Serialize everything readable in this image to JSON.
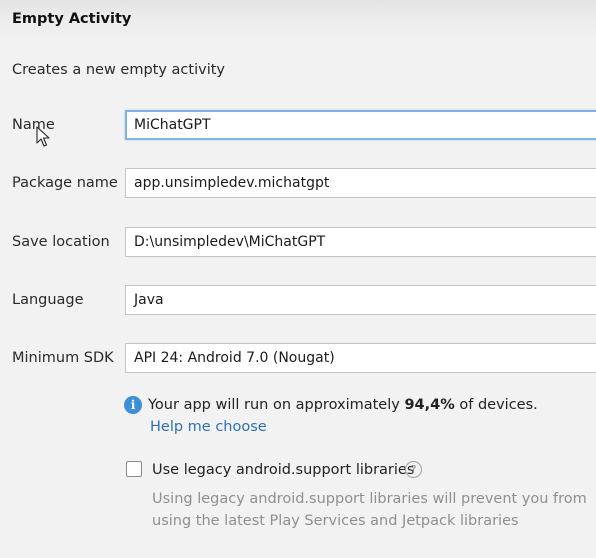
{
  "header": {
    "title": "Empty Activity"
  },
  "subtitle": "Creates a new empty activity",
  "form": {
    "name": {
      "label": "Name",
      "value": "MiChatGPT"
    },
    "package": {
      "label": "Package name",
      "value": "app.unsimpledev.michatgpt"
    },
    "save_location": {
      "label": "Save location",
      "value": "D:\\unsimpledev\\MiChatGPT"
    },
    "language": {
      "label": "Language",
      "value": "Java"
    },
    "min_sdk": {
      "label": "Minimum SDK",
      "value": "API 24: Android 7.0 (Nougat)"
    }
  },
  "info": {
    "icon": "info-icon",
    "prefix": "Your app will run on approximately ",
    "percent": "94,4%",
    "suffix": " of devices.",
    "help_link": "Help me choose"
  },
  "legacy": {
    "checked": false,
    "label": "Use legacy android.support libraries",
    "help_icon": "question-icon",
    "description": "Using legacy android.support libraries will prevent you from using the latest Play Services and Jetpack libraries"
  },
  "colors": {
    "accent": "#3d8fd6",
    "link": "#2f6eb5",
    "focus_border": "#7fb2df"
  }
}
